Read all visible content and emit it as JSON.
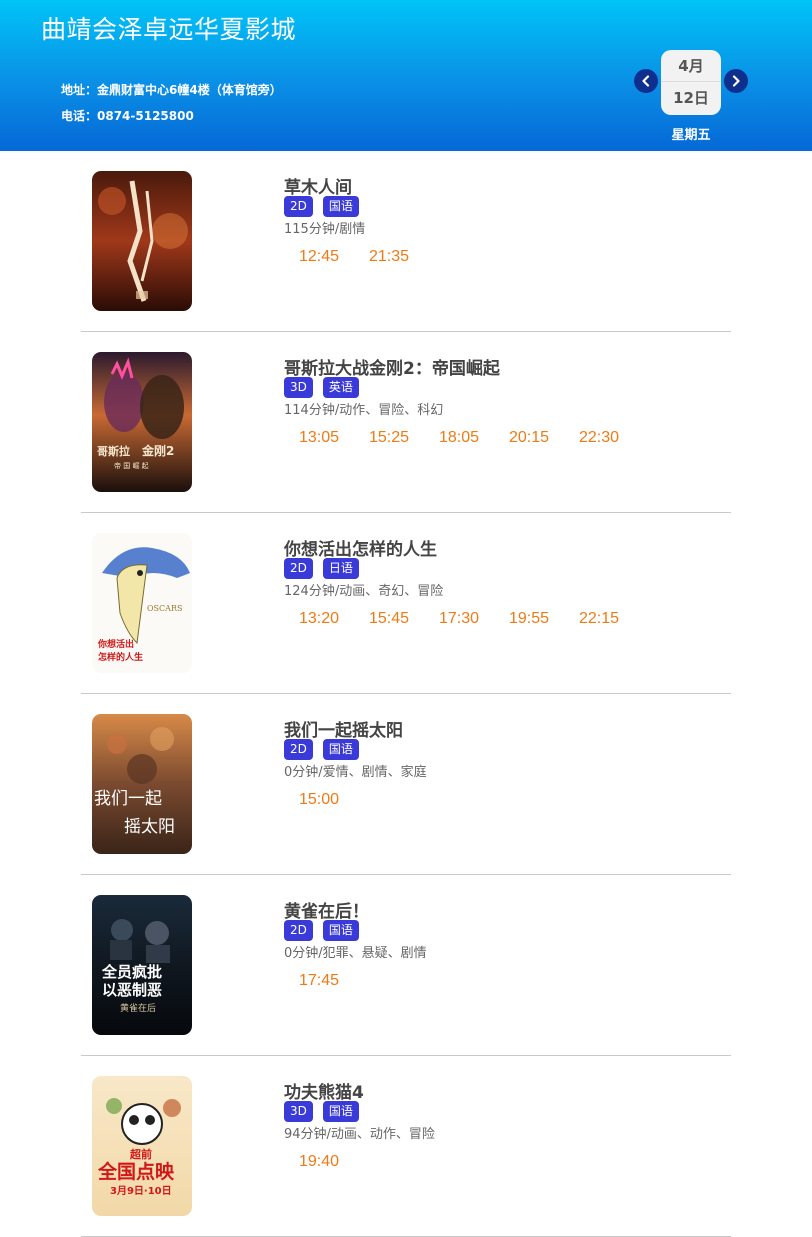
{
  "cinema": {
    "name": "曲靖会泽卓远华夏影城",
    "address": "地址：金鼎财富中心6幢4楼（体育馆旁）",
    "phone": "电话：0874-5125800"
  },
  "date": {
    "month": "4月",
    "day": "12日",
    "weekday": "星期五"
  },
  "colors": {
    "header_top": "#00c4f6",
    "header_bottom": "#0568d6",
    "badge": "#3a3ad8",
    "showtime": "#f07a14",
    "nav": "#0f2f8f"
  },
  "movies": [
    {
      "title": "草木人间",
      "format": "2D",
      "language": "国语",
      "meta": "115分钟/剧情",
      "times": [
        "12:45",
        "21:35"
      ]
    },
    {
      "title": "哥斯拉大战金刚2：帝国崛起",
      "format": "3D",
      "language": "英语",
      "meta": "114分钟/动作、冒险、科幻",
      "times": [
        "13:05",
        "15:25",
        "18:05",
        "20:15",
        "22:30"
      ],
      "poster_text": [
        "哥斯拉",
        "金刚2",
        "帝 国 崛 起"
      ]
    },
    {
      "title": "你想活出怎样的人生",
      "format": "2D",
      "language": "日语",
      "meta": "124分钟/动画、奇幻、冒险",
      "times": [
        "13:20",
        "15:45",
        "17:30",
        "19:55",
        "22:15"
      ],
      "poster_text": [
        "OSCARS",
        "你想活出",
        "怎样的人生"
      ]
    },
    {
      "title": "我们一起摇太阳",
      "format": "2D",
      "language": "国语",
      "meta": "0分钟/爱情、剧情、家庭",
      "times": [
        "15:00"
      ],
      "poster_text": [
        "我们一起",
        "摇太阳"
      ]
    },
    {
      "title": "黄雀在后！",
      "format": "2D",
      "language": "国语",
      "meta": "0分钟/犯罪、悬疑、剧情",
      "times": [
        "17:45"
      ],
      "poster_text": [
        "全员疯批",
        "以恶制恶",
        "黄雀在后"
      ]
    },
    {
      "title": "功夫熊猫4",
      "format": "3D",
      "language": "国语",
      "meta": "94分钟/动画、动作、冒险",
      "times": [
        "19:40"
      ],
      "poster_text": [
        "超前",
        "全国点映",
        "3月9日·10日"
      ]
    }
  ]
}
